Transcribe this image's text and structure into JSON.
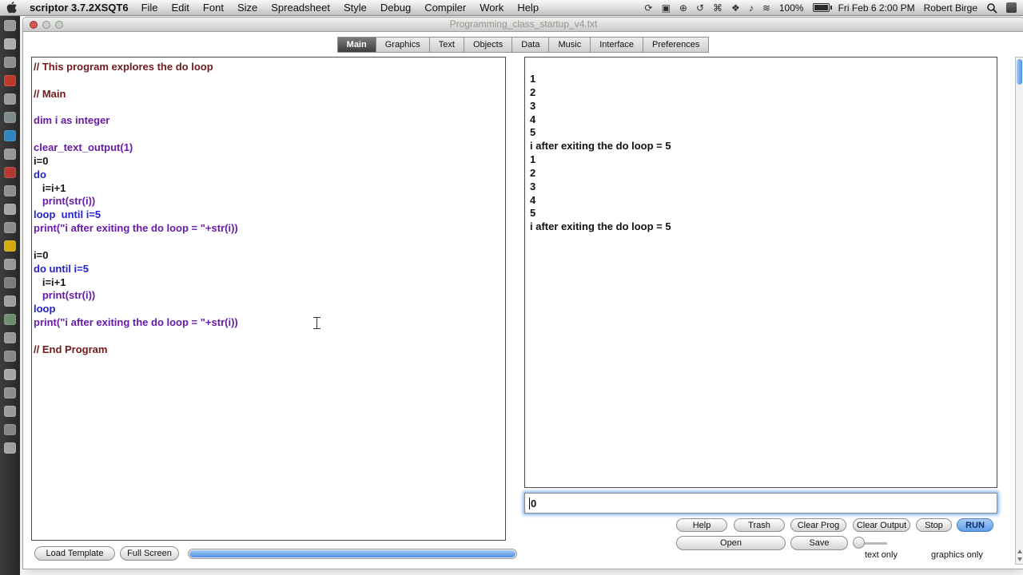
{
  "menubar": {
    "app_name": "scriptor 3.7.2XSQT6",
    "menus": [
      "File",
      "Edit",
      "Font",
      "Size",
      "Spreadsheet",
      "Style",
      "Debug",
      "Compiler",
      "Work",
      "Help"
    ],
    "status_icons": [
      {
        "name": "sync-icon",
        "glyph": "⟳"
      },
      {
        "name": "display-icon",
        "glyph": "▣"
      },
      {
        "name": "network-globe-icon",
        "glyph": "⊕"
      },
      {
        "name": "time-machine-icon",
        "glyph": "↺"
      },
      {
        "name": "keyboard-icon",
        "glyph": "⌘"
      },
      {
        "name": "bluetooth-icon",
        "glyph": "❖"
      },
      {
        "name": "volume-icon",
        "glyph": "♪"
      },
      {
        "name": "wifi-icon",
        "glyph": "≋"
      }
    ],
    "battery_percent": "100%",
    "clock": "Fri Feb 6 2:00 PM",
    "user": "Robert Birge"
  },
  "toolstrip": {
    "icons": [
      "#9a9a9a",
      "#b0b0b0",
      "#8f8f8f",
      "#c0392b",
      "#9a9a9a",
      "#7f8c8d",
      "#2e86c1",
      "#9a9a9a",
      "#b03a2e",
      "#909090",
      "#a6a6a6",
      "#8e8e8e",
      "#d4ac0d",
      "#9a9a9a",
      "#7d7d7d",
      "#a0a0a0",
      "#6f8f6f",
      "#9a9a9a",
      "#8a8a8a",
      "#a8a8a8",
      "#909090",
      "#9c9c9c",
      "#858585",
      "#a2a2a2"
    ]
  },
  "window": {
    "title": "Programming_class_startup_v4.txt",
    "tabs": [
      {
        "label": "Main",
        "name": "tab-main",
        "state": "active"
      },
      {
        "label": "Graphics",
        "name": "tab-graphics"
      },
      {
        "label": "Text",
        "name": "tab-text"
      },
      {
        "label": "Objects",
        "name": "tab-objects"
      },
      {
        "label": "Data",
        "name": "tab-data"
      },
      {
        "label": "Music",
        "name": "tab-music"
      },
      {
        "label": "Interface",
        "name": "tab-interface"
      },
      {
        "label": "Preferences",
        "name": "tab-preferences"
      }
    ]
  },
  "editor": {
    "lines": [
      {
        "text": "// This program explores the do loop",
        "color": "comment"
      },
      {
        "text": ""
      },
      {
        "text": "// Main",
        "color": "comment"
      },
      {
        "text": ""
      },
      {
        "text": "dim i as integer",
        "color": "purple"
      },
      {
        "text": ""
      },
      {
        "text": "clear_text_output(1)",
        "color": "purple"
      },
      {
        "text": "i=0",
        "color": "plain"
      },
      {
        "text": "do",
        "color": "blue"
      },
      {
        "text": "   i=i+1",
        "color": "plain"
      },
      {
        "text": "   print(str(i))",
        "color": "purple"
      },
      {
        "text": "loop  until i=5",
        "color": "blue"
      },
      {
        "text": "print(\"i after exiting the do loop = \"+str(i))",
        "color": "purple"
      },
      {
        "text": ""
      },
      {
        "text": "i=0",
        "color": "plain"
      },
      {
        "text": "do until i=5",
        "color": "blue"
      },
      {
        "text": "   i=i+1",
        "color": "plain"
      },
      {
        "text": "   print(str(i))",
        "color": "purple"
      },
      {
        "text": "loop",
        "color": "blue"
      },
      {
        "text": "print(\"i after exiting the do loop = \"+str(i))",
        "color": "purple"
      },
      {
        "text": ""
      },
      {
        "text": "// End Program",
        "color": "comment"
      }
    ]
  },
  "output": {
    "lines": [
      "1",
      "2",
      "3",
      "4",
      "5",
      "i after exiting the do loop = 5",
      "1",
      "2",
      "3",
      "4",
      "5",
      "i after exiting the do loop = 5"
    ]
  },
  "console": {
    "value": "0"
  },
  "controls": {
    "help": "Help",
    "trash": "Trash",
    "clear_prog": "Clear Prog",
    "clear_output": "Clear Output",
    "stop": "Stop",
    "run": "RUN",
    "open": "Open",
    "save": "Save",
    "text_only": "text only",
    "graphics_only": "graphics only",
    "load_template": "Load Template",
    "full_screen": "Full Screen"
  },
  "colors": {
    "run_button": "#5e9de8",
    "scroll_thumb": "#4e8ede",
    "comment": "#6e1a1a",
    "keyword_blue": "#2222cc",
    "builtin_purple": "#681ba8"
  }
}
